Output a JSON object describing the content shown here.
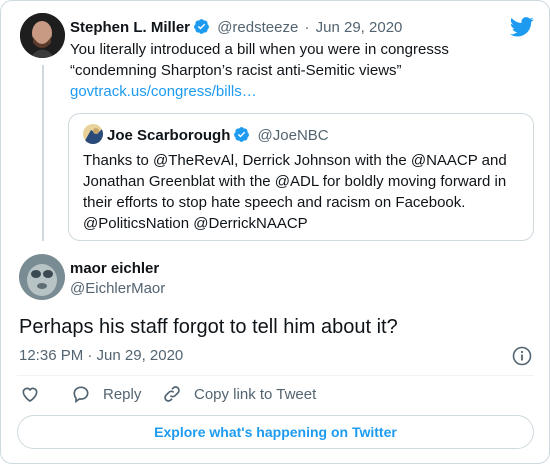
{
  "parent_tweet": {
    "display_name": "Stephen L. Miller",
    "handle": "@redsteeze",
    "separator": "·",
    "date": "Jun 29, 2020",
    "text_line1": "You literally introduced a bill when you were in congresss",
    "text_line2": "“condemning Sharpton’s racist anti-Semitic views”",
    "link_text": "govtrack.us/congress/bills…"
  },
  "quoted_tweet": {
    "display_name": "Joe Scarborough",
    "handle": "@JoeNBC",
    "lines": [
      "Thanks to @TheRevAl, Derrick Johnson with the @NAACP and",
      "Jonathan Greenblat with the @ADL for boldly moving forward in",
      "their efforts to stop hate speech and racism on Facebook.",
      "@PoliticsNation @DerrickNAACP"
    ]
  },
  "main_tweet": {
    "display_name": "maor eichler",
    "handle": "@EichlerMaor",
    "text": "Perhaps his staff forgot to tell him about it?",
    "timestamp": "12:36 PM · Jun 29, 2020"
  },
  "actions": {
    "reply_label": "Reply",
    "copy_link_label": "Copy link to Tweet"
  },
  "explore_label": "Explore what's happening on Twitter",
  "colors": {
    "accent": "#1d9bf0",
    "text": "#0f1419",
    "muted": "#536471",
    "border": "#cfd9de"
  },
  "icons": [
    "twitter-bird-icon",
    "verified-badge-icon",
    "info-icon",
    "heart-icon",
    "reply-icon",
    "link-icon"
  ]
}
